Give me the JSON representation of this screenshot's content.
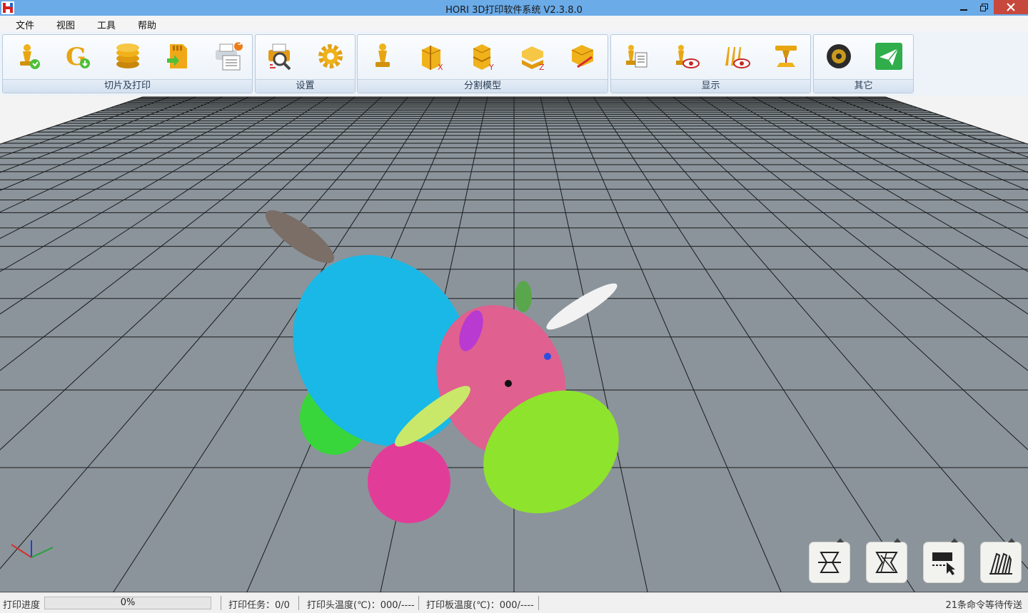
{
  "window": {
    "title": "HORI 3D打印软件系统 V2.3.8.0",
    "logo_letter": "H"
  },
  "menu": [
    "文件",
    "视图",
    "工具",
    "帮助"
  ],
  "ribbon": {
    "groups": [
      {
        "label": "切片及打印",
        "buttons": [
          "slice-print-icon",
          "gcode-download-icon",
          "layers-stack-icon",
          "sd-card-import-icon",
          "print-queue-icon"
        ],
        "badge": "5"
      },
      {
        "label": "设置",
        "buttons": [
          "printer-search-icon",
          "settings-gear-icon"
        ]
      },
      {
        "label": "分割模型",
        "buttons": [
          "chess-piece-icon",
          "split-x-icon",
          "split-y-icon",
          "split-z-icon",
          "split-custom-icon"
        ]
      },
      {
        "label": "显示",
        "buttons": [
          "model-list-icon",
          "preview-eye-icon",
          "support-view-icon",
          "nozzle-icon"
        ]
      },
      {
        "label": "其它",
        "buttons": [
          "disc-icon",
          "send-icon"
        ]
      }
    ],
    "split_axes": [
      "X",
      "Y",
      "Z"
    ]
  },
  "viewport": {
    "floor_color": "#8b949b",
    "grid_color": "#1a1a1a",
    "sky_color": "#f3f3f3",
    "model_colors": {
      "body": "#19b8e6",
      "head": "#e0608f",
      "snout": "#8ee32c",
      "leg_back": "#38d63a",
      "leg_front": "#e23c99",
      "tail": "#7a6e66",
      "ear": "#b83ad1",
      "horn": "#5aa64d",
      "horn_big": "#f2f2f2",
      "leaf": "#c9e86a"
    },
    "side_tools": [
      "cross-section-icon",
      "slice-layer-icon",
      "select-area-icon",
      "support-icon"
    ]
  },
  "status": {
    "progress_label": "打印进度",
    "progress_value": 0,
    "progress_text": "0%",
    "task": "打印任务：0/0",
    "head_temp": "打印头温度(℃)：000/----",
    "bed_temp": "打印板温度(℃)：000/----",
    "queue": "21条命令等待传送"
  }
}
